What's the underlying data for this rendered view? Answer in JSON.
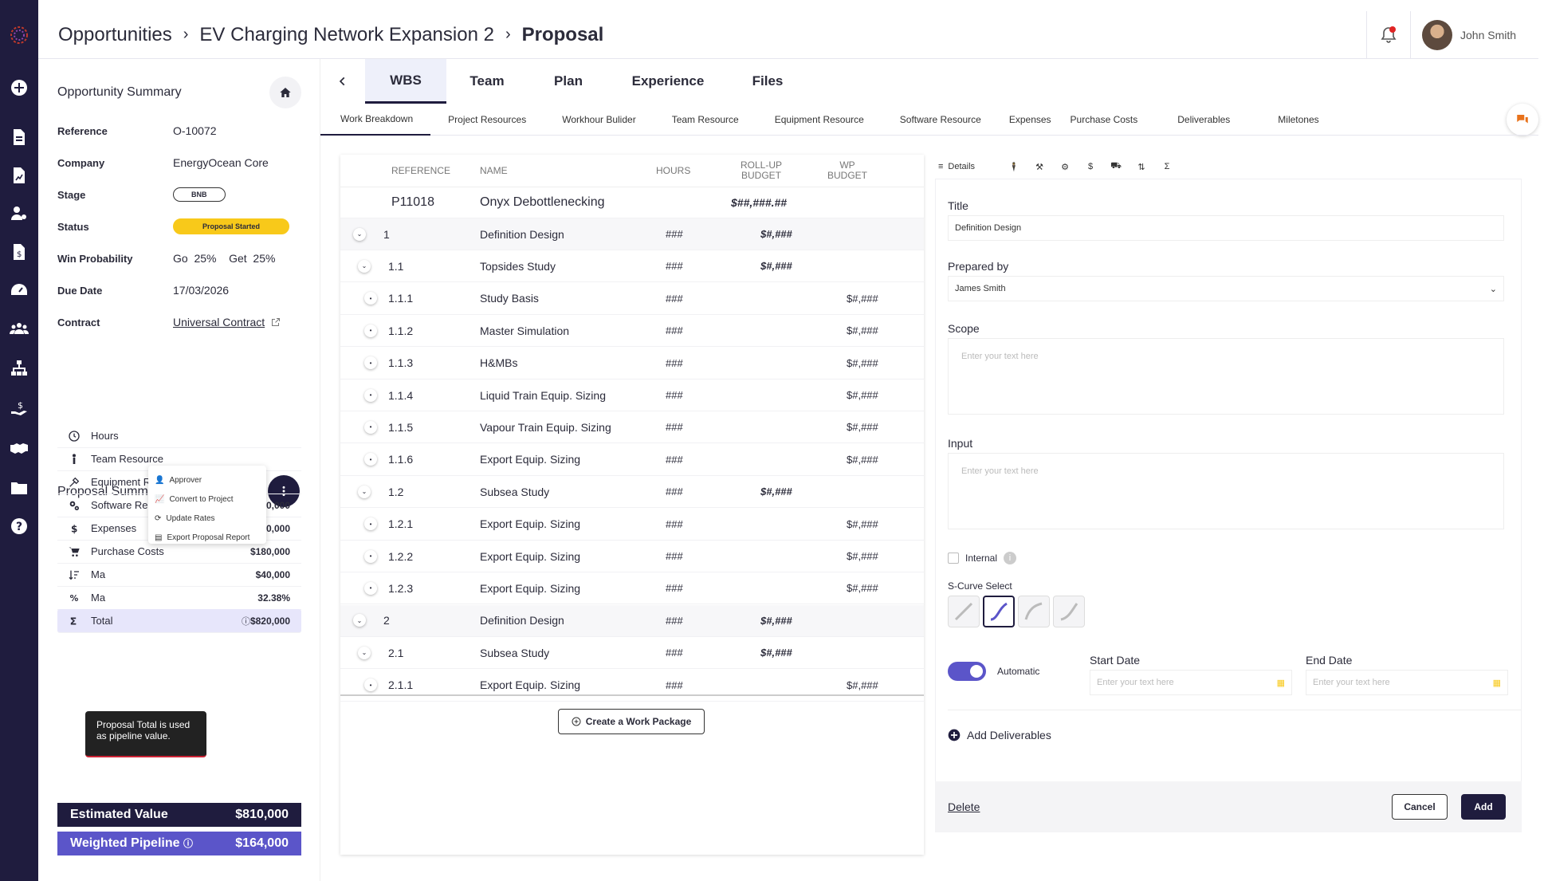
{
  "breadcrumb": {
    "items": [
      "Opportunities",
      "EV Charging Network Expansion 2",
      "Proposal"
    ]
  },
  "user": {
    "name": "John Smith"
  },
  "opportunity": {
    "title": "Opportunity Summary",
    "fields": [
      {
        "key": "Reference",
        "value": "O-10072"
      },
      {
        "key": "Company",
        "value": "EnergyOcean Core"
      },
      {
        "key": "Stage",
        "value": "BNB"
      },
      {
        "key": "Status",
        "value": "Proposal Started"
      },
      {
        "key": "Win Probability",
        "go_label": "Go",
        "go": "25%",
        "get_label": "Get",
        "get": "25%"
      },
      {
        "key": "Due Date",
        "value": "17/03/2026"
      },
      {
        "key": "Contract",
        "value": "Universal Contract"
      }
    ]
  },
  "proposal": {
    "title": "Proposal Summary",
    "rows": [
      {
        "label": "Hours",
        "value": "",
        "icon": "clock-icon"
      },
      {
        "label": "Team Resource",
        "value": "",
        "icon": "person-icon"
      },
      {
        "label": "Equipment Resou",
        "value": "",
        "icon": "tools-icon"
      },
      {
        "label": "Software Resource",
        "value": "$150,000",
        "icon": "gears-icon"
      },
      {
        "label": "Expenses",
        "value": "$80,000",
        "icon": "dollar-icon"
      },
      {
        "label": "Purchase Costs",
        "value": "$180,000",
        "icon": "cart-icon"
      },
      {
        "label": "Ma",
        "value": "$40,000",
        "icon": "sort-icon"
      },
      {
        "label": "Ma",
        "value": "32.38%",
        "icon": "percent-icon"
      },
      {
        "label": "Total",
        "value": "$820,000",
        "icon": "sigma-icon"
      }
    ],
    "estimated_label": "Estimated Value",
    "estimated_value": "$810,000",
    "weighted_label": "Weighted Pipeline",
    "weighted_value": "$164,000",
    "menu": [
      "Approver",
      "Convert to Project",
      "Update Rates",
      "Export Proposal Report"
    ],
    "tooltip": "Proposal Total is used as pipeline value."
  },
  "tabs": [
    "WBS",
    "Team",
    "Plan",
    "Experience",
    "Files"
  ],
  "subtabs": [
    "Work Breakdown",
    "Project Resources",
    "Workhour Bulider",
    "Team Resource",
    "Equipment Resource",
    "Software Resource",
    "Expenses",
    "Purchase Costs",
    "Deliverables",
    "Miletones"
  ],
  "wbs": {
    "headers": {
      "reference": "REFERENCE",
      "name": "NAME",
      "hours": "HOURS",
      "rollup": "ROLL-UP BUDGET",
      "wp": "WP BUDGET"
    },
    "first": {
      "ref": "P11018",
      "name": "Onyx Debottlenecking",
      "rollup": "$##,###.##"
    },
    "rows": [
      {
        "ref": "1",
        "name": "Definition Design",
        "hours": "###",
        "rollup": "$#,###",
        "wp": "",
        "level": 0,
        "expand": true
      },
      {
        "ref": "1.1",
        "name": "Topsides Study",
        "hours": "###",
        "rollup": "$#,###",
        "wp": "",
        "level": 1,
        "expand": true
      },
      {
        "ref": "1.1.1",
        "name": "Study Basis",
        "hours": "###",
        "rollup": "",
        "wp": "$#,###",
        "level": 2
      },
      {
        "ref": "1.1.2",
        "name": "Master Simulation",
        "hours": "###",
        "rollup": "",
        "wp": "$#,###",
        "level": 2
      },
      {
        "ref": "1.1.3",
        "name": "H&MBs",
        "hours": "###",
        "rollup": "",
        "wp": "$#,###",
        "level": 2
      },
      {
        "ref": "1.1.4",
        "name": "Liquid Train Equip. Sizing",
        "hours": "###",
        "rollup": "",
        "wp": "$#,###",
        "level": 2
      },
      {
        "ref": "1.1.5",
        "name": "Vapour Train Equip. Sizing",
        "hours": "###",
        "rollup": "",
        "wp": "$#,###",
        "level": 2
      },
      {
        "ref": "1.1.6",
        "name": "Export Equip. Sizing",
        "hours": "###",
        "rollup": "",
        "wp": "$#,###",
        "level": 2
      },
      {
        "ref": "1.2",
        "name": "Subsea Study",
        "hours": "###",
        "rollup": "$#,###",
        "wp": "",
        "level": 1,
        "expand": true
      },
      {
        "ref": "1.2.1",
        "name": "Export Equip. Sizing",
        "hours": "###",
        "rollup": "",
        "wp": "$#,###",
        "level": 2
      },
      {
        "ref": "1.2.2",
        "name": "Export Equip. Sizing",
        "hours": "###",
        "rollup": "",
        "wp": "$#,###",
        "level": 2
      },
      {
        "ref": "1.2.3",
        "name": "Export Equip. Sizing",
        "hours": "###",
        "rollup": "",
        "wp": "$#,###",
        "level": 2
      },
      {
        "ref": "2",
        "name": "Definition Design",
        "hours": "###",
        "rollup": "$#,###",
        "wp": "",
        "level": 0,
        "expand": true
      },
      {
        "ref": "2.1",
        "name": "Subsea Study",
        "hours": "###",
        "rollup": "$#,###",
        "wp": "",
        "level": 1,
        "expand": true
      },
      {
        "ref": "2.1.1",
        "name": "Export Equip. Sizing",
        "hours": "###",
        "rollup": "",
        "wp": "$#,###",
        "level": 2
      }
    ],
    "create_label": "Create a Work Package"
  },
  "details": {
    "tab_label": "Details",
    "title_label": "Title",
    "title_value": "Definition Design",
    "prepared_label": "Prepared by",
    "prepared_value": "James Smith",
    "scope_label": "Scope",
    "scope_placeholder": "Enter your text here",
    "input_label": "Input",
    "input_placeholder": "Enter your text here",
    "internal_label": "Internal",
    "scurve_label": "S-Curve Select",
    "automatic_label": "Automatic",
    "start_label": "Start Date",
    "start_placeholder": "Enter your text here",
    "end_label": "End Date",
    "end_placeholder": "Enter your text here",
    "add_deliverables": "Add Deliverables",
    "delete_label": "Delete",
    "cancel_label": "Cancel",
    "add_label": "Add"
  },
  "colors": {
    "navy": "#1f1c3e",
    "accent": "#5b55c9",
    "status_yellow": "#f8c91a",
    "notification": "#e02424",
    "chat": "#e8721c"
  }
}
